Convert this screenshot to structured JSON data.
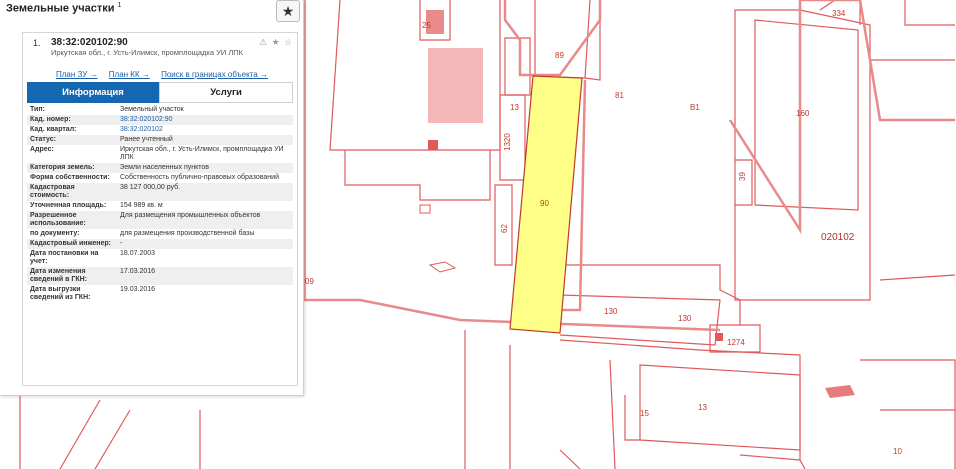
{
  "panel": {
    "title": "Земельные участки",
    "count": "1",
    "favorite_icon": "star-icon"
  },
  "result": {
    "index": "1.",
    "cad_number": "38:32:020102:90",
    "address": "Иркутская обл., г. Усть-Илимск, промплощадка УИ ЛПК",
    "icons": "⚠ ★ ☆",
    "links": [
      "План ЗУ →",
      "План КК →",
      "Поиск в границах объекта →"
    ],
    "tabs": [
      "Информация",
      "Услуги"
    ],
    "rows": [
      {
        "key": "Тип:",
        "value": "Земельный участок"
      },
      {
        "key": "Кад. номер:",
        "value": "38:32:020102:90"
      },
      {
        "key": "Кад. квартал:",
        "value": "38:32:020102"
      },
      {
        "key": "Статус:",
        "value": "Ранее учтенный"
      },
      {
        "key": "Адрес:",
        "value": "Иркутская обл., г. Усть-Илимск, промплощадка УИ ЛПК"
      },
      {
        "key": "Категория земель:",
        "value": "Земли населенных пунктов"
      },
      {
        "key": "Форма собственности:",
        "value": "Собственность публично-правовых образований"
      },
      {
        "key": "Кадастровая стоимость:",
        "value": "38 127 000,00 руб."
      },
      {
        "key": "Уточненная площадь:",
        "value": "154 989 кв. м"
      },
      {
        "key": "Разрешенное использование:",
        "value": "Для размещения промышленных объектов"
      },
      {
        "key": "по документу:",
        "value": "для размещения производственной базы"
      },
      {
        "key": "Кадастровый инженер:",
        "value": "-"
      },
      {
        "key": "Дата постановки на учет:",
        "value": "18.07.2003"
      },
      {
        "key": "Дата изменения сведений в ГКН:",
        "value": "17.03.2016"
      },
      {
        "key": "Дата выгрузки сведений из ГКН:",
        "value": "19.03.2016"
      }
    ]
  },
  "map": {
    "colors": {
      "parcel_line": "#e05a5a",
      "selected_fill": "#ffff88",
      "building_fill": "#f4b7b7",
      "quarter_line": "#e88a8a"
    },
    "labels": [
      "25",
      "89",
      "81",
      "B1",
      "13",
      "1320",
      "90",
      "62",
      "130",
      "130",
      "1274",
      "160",
      "334",
      "39",
      "020102",
      "15",
      "13",
      "10",
      "09"
    ]
  }
}
